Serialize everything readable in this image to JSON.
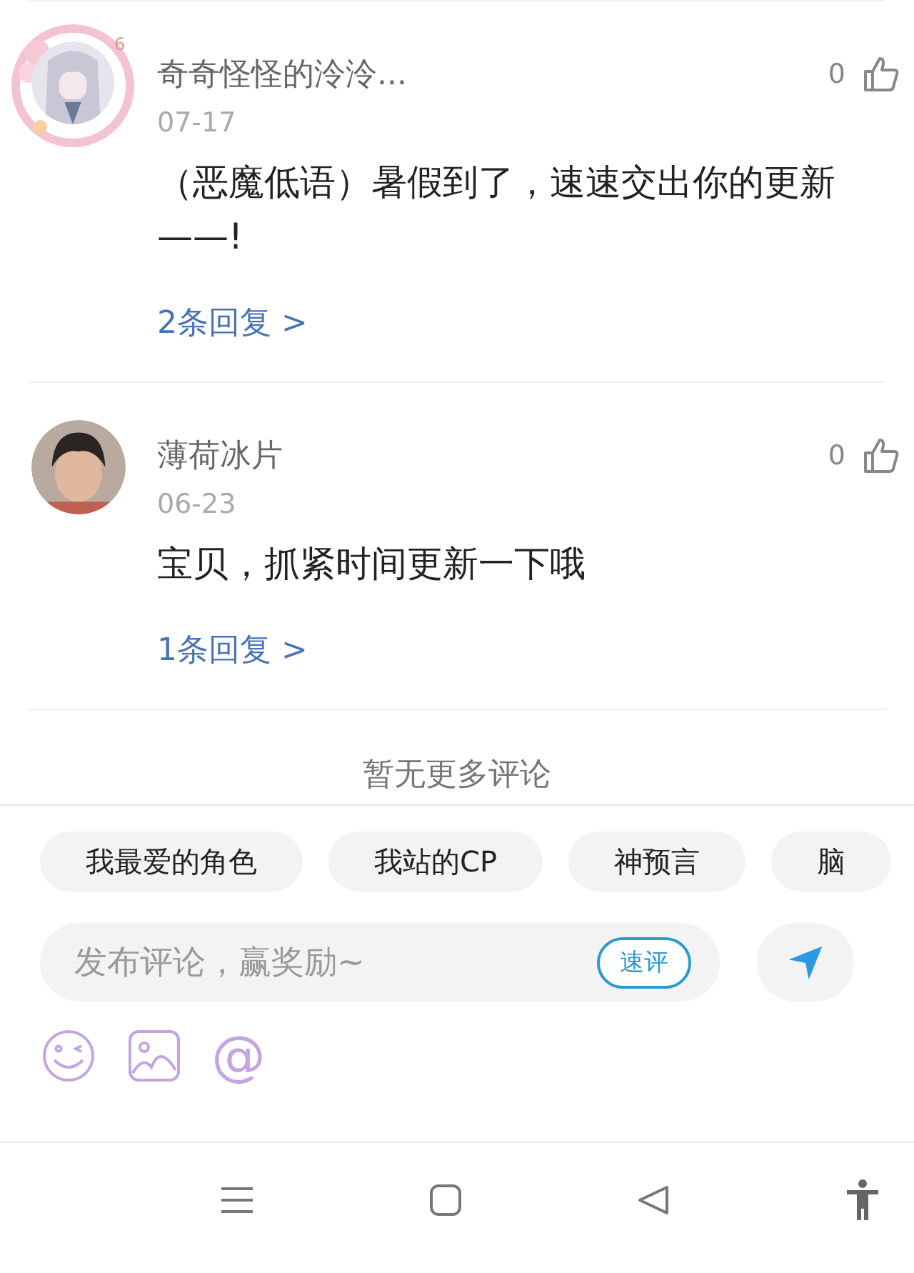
{
  "comments": [
    {
      "name": "奇奇怪怪的泠泠...",
      "avatar": {
        "kind": "picture",
        "frame": true,
        "frame_badge": "6"
      },
      "date": "07-17",
      "likes": "0",
      "liked": false,
      "text": "（恶魔低语）暑假到了，速速交出你的更新——!",
      "replies": "2条回复 >"
    },
    {
      "name": "薄荷冰片",
      "date": "06-23",
      "likes": "0",
      "liked": false,
      "text": "宝贝，抓紧时间更新一下哦",
      "replies": "1条回复 >"
    }
  ],
  "end_note": "暂无更多评论",
  "quick_tags": [
    {
      "label": "我最爱的角色"
    },
    {
      "label": "我站的CP"
    },
    {
      "label": "神预言"
    },
    {
      "label": "脑"
    }
  ],
  "input": {
    "placeholder": "发布评论，赢奖励~",
    "quick_button": "速评"
  },
  "mention_label": "@"
}
